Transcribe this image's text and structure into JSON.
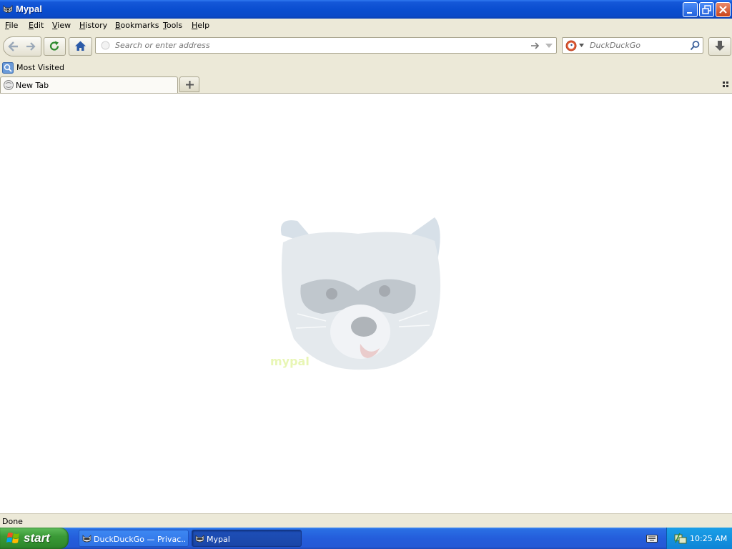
{
  "window": {
    "title": "Mypal"
  },
  "menu": [
    "File",
    "Edit",
    "View",
    "History",
    "Bookmarks",
    "Tools",
    "Help"
  ],
  "menu_mnemonics": [
    "F",
    "E",
    "V",
    "H",
    "B",
    "T",
    "H"
  ],
  "nav": {
    "address_placeholder": "Search or enter address",
    "search_engine": "DuckDuckGo",
    "search_placeholder": "DuckDuckGo"
  },
  "bookmarks": {
    "most_visited": "Most Visited"
  },
  "tabs": [
    {
      "label": "New Tab",
      "active": true
    }
  ],
  "content": {
    "mascot_caption": "mypal"
  },
  "status": {
    "text": "Done"
  },
  "taskbar": {
    "start_label": "start",
    "tasks": [
      {
        "label": "DuckDuckGo — Privac...",
        "active": false
      },
      {
        "label": "Mypal",
        "active": true
      }
    ],
    "clock": "10:25 AM"
  },
  "colors": {
    "titlebar_blue": "#0a4ed0",
    "chrome_beige": "#ece9d8",
    "start_green": "#3b9a37",
    "tray_blue": "#0f84d6"
  },
  "icons": [
    "raccoon-app-icon",
    "back-icon",
    "forward-icon",
    "reload-icon",
    "home-icon",
    "go-arrow-icon",
    "dropdown-icon",
    "duckduckgo-icon",
    "search-icon",
    "download-icon",
    "most-visited-icon",
    "new-tab-icon",
    "plus-icon",
    "grid-icon",
    "windows-flag-icon",
    "keyboard-icon",
    "network-icon"
  ]
}
